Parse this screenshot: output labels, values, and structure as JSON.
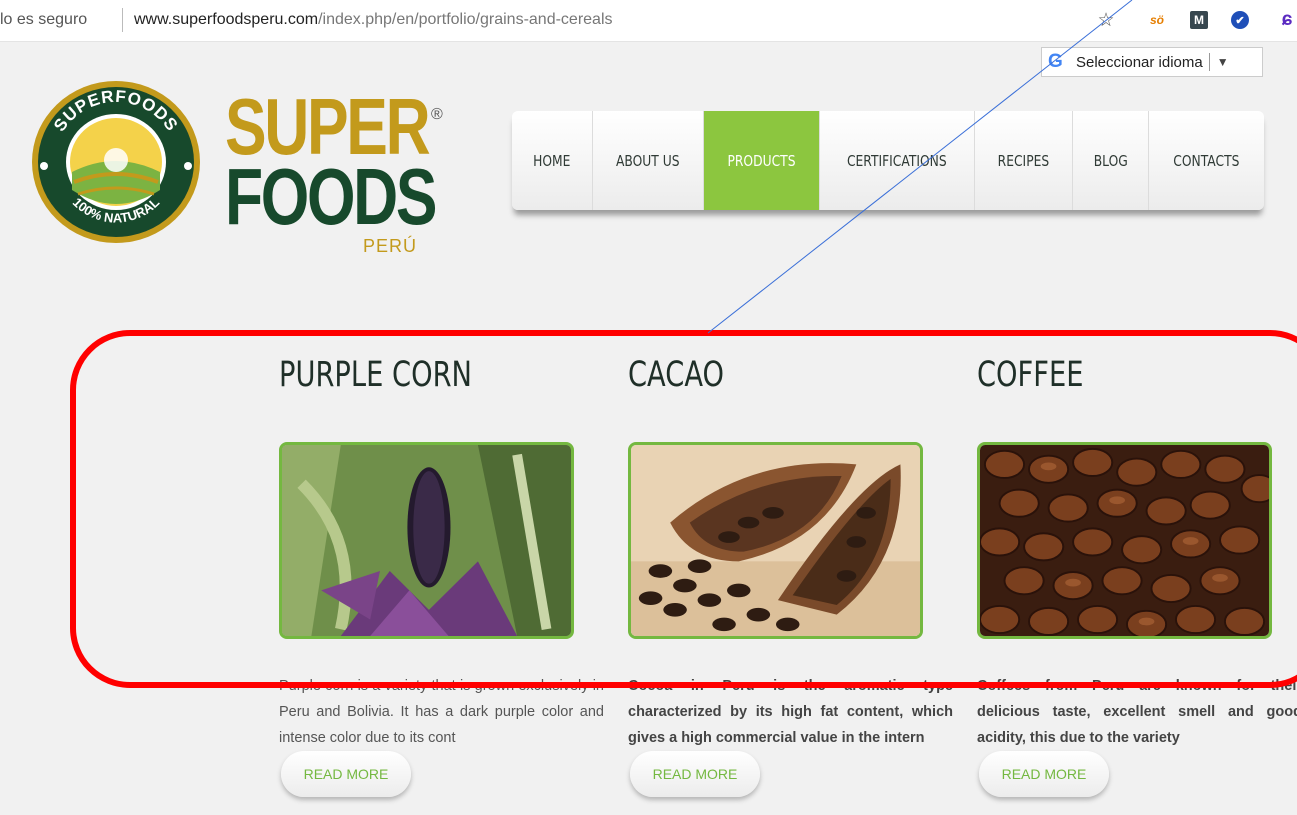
{
  "browser": {
    "security": "lo es seguro",
    "url_host": "www.superfoodsperu.com",
    "url_path": "/index.php/en/portfolio/grains-and-cereals",
    "extensions": {
      "so_text": "sö",
      "m_text": "M",
      "e_text": "ɕ"
    }
  },
  "translate": {
    "label": "Seleccionar idioma",
    "arrow": "▼"
  },
  "brand": {
    "badge_top": "SUPERFOODS",
    "badge_bottom": "100% NATURAL",
    "super": "SUPER",
    "foods": "FOODS",
    "peru": "PERÚ",
    "reg": "®"
  },
  "nav": {
    "items": [
      {
        "label": "HOME"
      },
      {
        "label": "ABOUT US"
      },
      {
        "label": "PRODUCTS",
        "active": true
      },
      {
        "label": "CERTIFICATIONS"
      },
      {
        "label": "RECIPES"
      },
      {
        "label": "BLOG"
      },
      {
        "label": "CONTACTS"
      }
    ]
  },
  "products": [
    {
      "title": "PURPLE CORN",
      "desc": "Purple corn is a variety that is grown exclusively in Peru and Bolivia. It has a dark purple color and intense color due to its cont",
      "read_more": "READ MORE"
    },
    {
      "title": "CACAO",
      "desc": "Cocoa in Peru is the aromatic type characterized by its high fat content, which gives a high commercial value in the intern",
      "read_more": "READ MORE"
    },
    {
      "title": "COFFEE",
      "desc": "Coffees from Peru are known for their delicious taste, excellent smell and good acidity, this due to the variety",
      "read_more": "READ MORE"
    }
  ],
  "colors": {
    "accent_green": "#8cc63f",
    "frame_green": "#74b840",
    "brand_gold": "#c39a1c",
    "brand_dark_green": "#17492c",
    "annotation_red": "#ff0000",
    "annotation_line": "#3a6fd8"
  }
}
